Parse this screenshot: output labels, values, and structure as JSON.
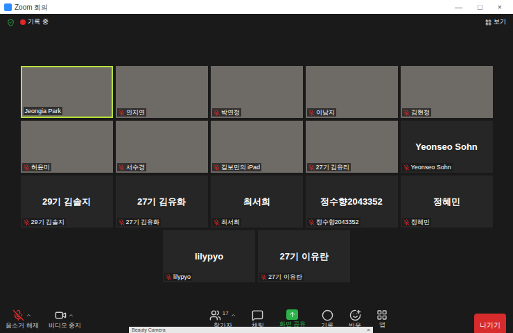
{
  "window": {
    "title": "Zoom 회의",
    "controls": [
      "—",
      "□",
      "×"
    ]
  },
  "top_bar": {
    "recording": "기록 중",
    "view_button": "보기"
  },
  "participants": [
    {
      "name": "Jeongia Park",
      "video": true,
      "highlighted": true,
      "muted": false
    },
    {
      "name": "안지연",
      "video": true,
      "highlighted": false,
      "muted": true
    },
    {
      "name": "박연정",
      "video": true,
      "highlighted": false,
      "muted": true
    },
    {
      "name": "이남지",
      "video": true,
      "highlighted": false,
      "muted": true
    },
    {
      "name": "김현정",
      "video": true,
      "highlighted": false,
      "muted": true
    },
    {
      "name": "허윤미",
      "video": true,
      "highlighted": false,
      "muted": true
    },
    {
      "name": "서수경",
      "video": true,
      "highlighted": false,
      "muted": true
    },
    {
      "name": "길보민의 iPad",
      "video": true,
      "highlighted": false,
      "muted": true
    },
    {
      "name": "27기 김유리",
      "video": true,
      "highlighted": false,
      "muted": true
    },
    {
      "name": "Yeonseo Sohn",
      "video": false,
      "highlighted": false,
      "muted": true
    },
    {
      "name": "29기 김솔지",
      "video": false,
      "highlighted": false,
      "muted": true
    },
    {
      "name": "27기 김유화",
      "video": false,
      "highlighted": false,
      "muted": true
    },
    {
      "name": "최서희",
      "video": false,
      "highlighted": false,
      "muted": true
    },
    {
      "name": "정수향2043352",
      "video": false,
      "highlighted": false,
      "muted": true
    },
    {
      "name": "정혜민",
      "video": false,
      "highlighted": false,
      "muted": true
    },
    {
      "name": "lilypyo",
      "video": false,
      "highlighted": false,
      "muted": true
    },
    {
      "name": "27기 이유란",
      "video": false,
      "highlighted": false,
      "muted": true
    }
  ],
  "toolbar": {
    "left": [
      {
        "kind": "mic",
        "label": "음소거 해제",
        "muted": true
      },
      {
        "kind": "video",
        "label": "비디오 중지",
        "muted": false
      }
    ],
    "center": [
      {
        "kind": "participants",
        "label": "참가자",
        "count": "17"
      },
      {
        "kind": "chat",
        "label": "채팅",
        "count": ""
      },
      {
        "kind": "share",
        "label": "화면 공유",
        "count": ""
      },
      {
        "kind": "record",
        "label": "기록",
        "count": ""
      },
      {
        "kind": "reactions",
        "label": "반응",
        "count": ""
      },
      {
        "kind": "apps",
        "label": "앱",
        "count": ""
      }
    ],
    "leave_button": "나가기"
  },
  "overlay": {
    "title": "Beauty Camera",
    "close": "×"
  }
}
